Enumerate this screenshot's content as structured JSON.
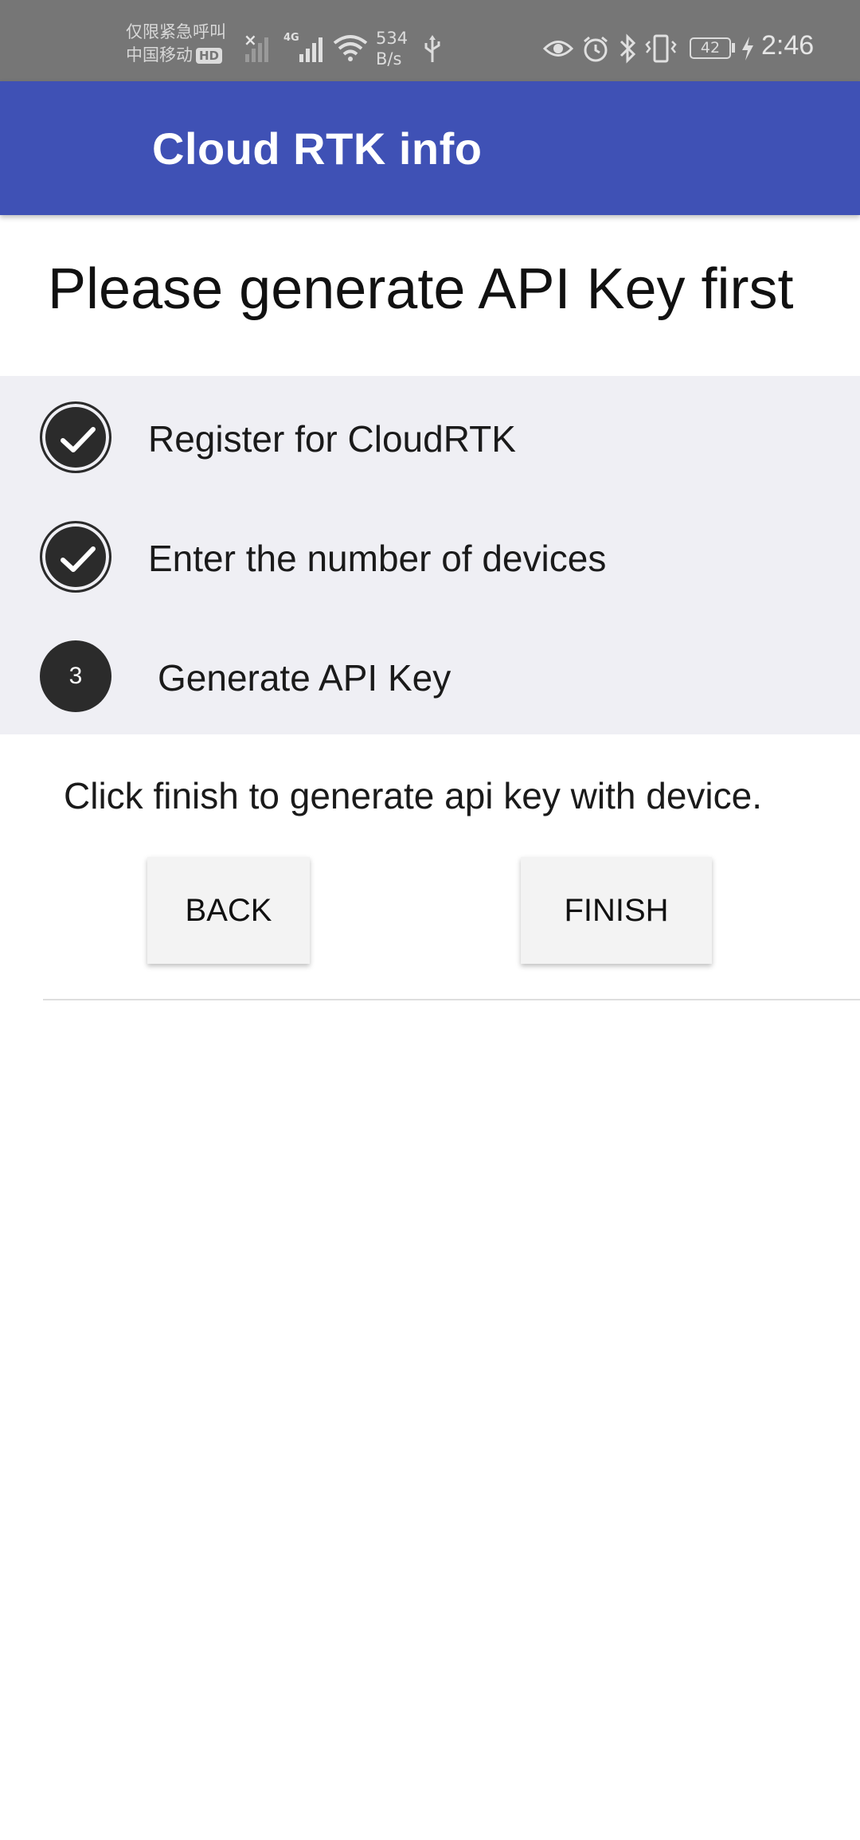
{
  "status_bar": {
    "carrier_line1": "仅限紧急呼叫",
    "carrier_line2": "中国移动",
    "hd_badge": "HD",
    "network_type": "4G",
    "net_speed_value": "534",
    "net_speed_unit": "B/s",
    "battery_level": "42",
    "time": "2:46",
    "icons": [
      "signal-icon",
      "wifi-icon",
      "usb-icon",
      "eye-icon",
      "alarm-icon",
      "bluetooth-icon",
      "vibrate-icon",
      "battery-icon",
      "charging-icon"
    ]
  },
  "app_bar": {
    "title": "Cloud RTK info",
    "color": "#3f51b5"
  },
  "main": {
    "heading": "Please generate API Key first",
    "steps": [
      {
        "status": "done",
        "icon": "check-icon",
        "label": "Register for CloudRTK"
      },
      {
        "status": "done",
        "icon": "check-icon",
        "label": "Enter the number of devices"
      },
      {
        "status": "current",
        "number": "3",
        "label": "Generate API Key"
      }
    ],
    "instruction": "Click finish to generate api key with device.",
    "back_label": "BACK",
    "finish_label": "FINISH"
  }
}
